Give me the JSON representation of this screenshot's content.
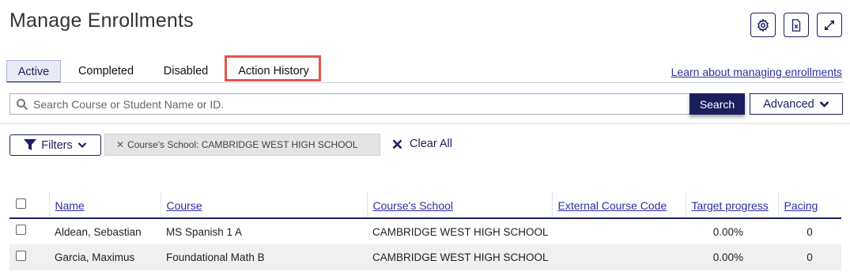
{
  "page": {
    "title": "Manage Enrollments"
  },
  "toolbar": {
    "icons": [
      "gear-icon",
      "excel-file-icon",
      "expand-icon"
    ]
  },
  "tabs": [
    {
      "label": "Active",
      "active": true
    },
    {
      "label": "Completed",
      "active": false
    },
    {
      "label": "Disabled",
      "active": false
    },
    {
      "label": "Action History",
      "active": false,
      "highlighted": true
    }
  ],
  "learn_link": "Learn about managing enrollments",
  "search": {
    "placeholder": "Search Course or Student Name or ID.",
    "value": "",
    "button_label": "Search",
    "advanced_label": "Advanced"
  },
  "filters": {
    "button_label": "Filters",
    "chip_label": "Course's School: CAMBRIDGE WEST HIGH SCHOOL",
    "clear_all_label": "Clear All"
  },
  "table": {
    "columns": [
      "Name",
      "Course",
      "Course's School",
      "External Course Code",
      "Target progress",
      "Pacing"
    ],
    "rows": [
      {
        "name": "Aldean, Sebastian",
        "course": "MS Spanish 1 A",
        "school": "CAMBRIDGE WEST HIGH SCHOOL",
        "external_code": "",
        "target_progress": "0.00%",
        "pacing": "0"
      },
      {
        "name": "Garcia, Maximus",
        "course": "Foundational Math B",
        "school": "CAMBRIDGE WEST HIGH SCHOOL",
        "external_code": "",
        "target_progress": "0.00%",
        "pacing": "0"
      }
    ]
  },
  "colors": {
    "primary": "#1c1f5e",
    "link": "#2d2fa0",
    "highlight": "#e8544a"
  }
}
